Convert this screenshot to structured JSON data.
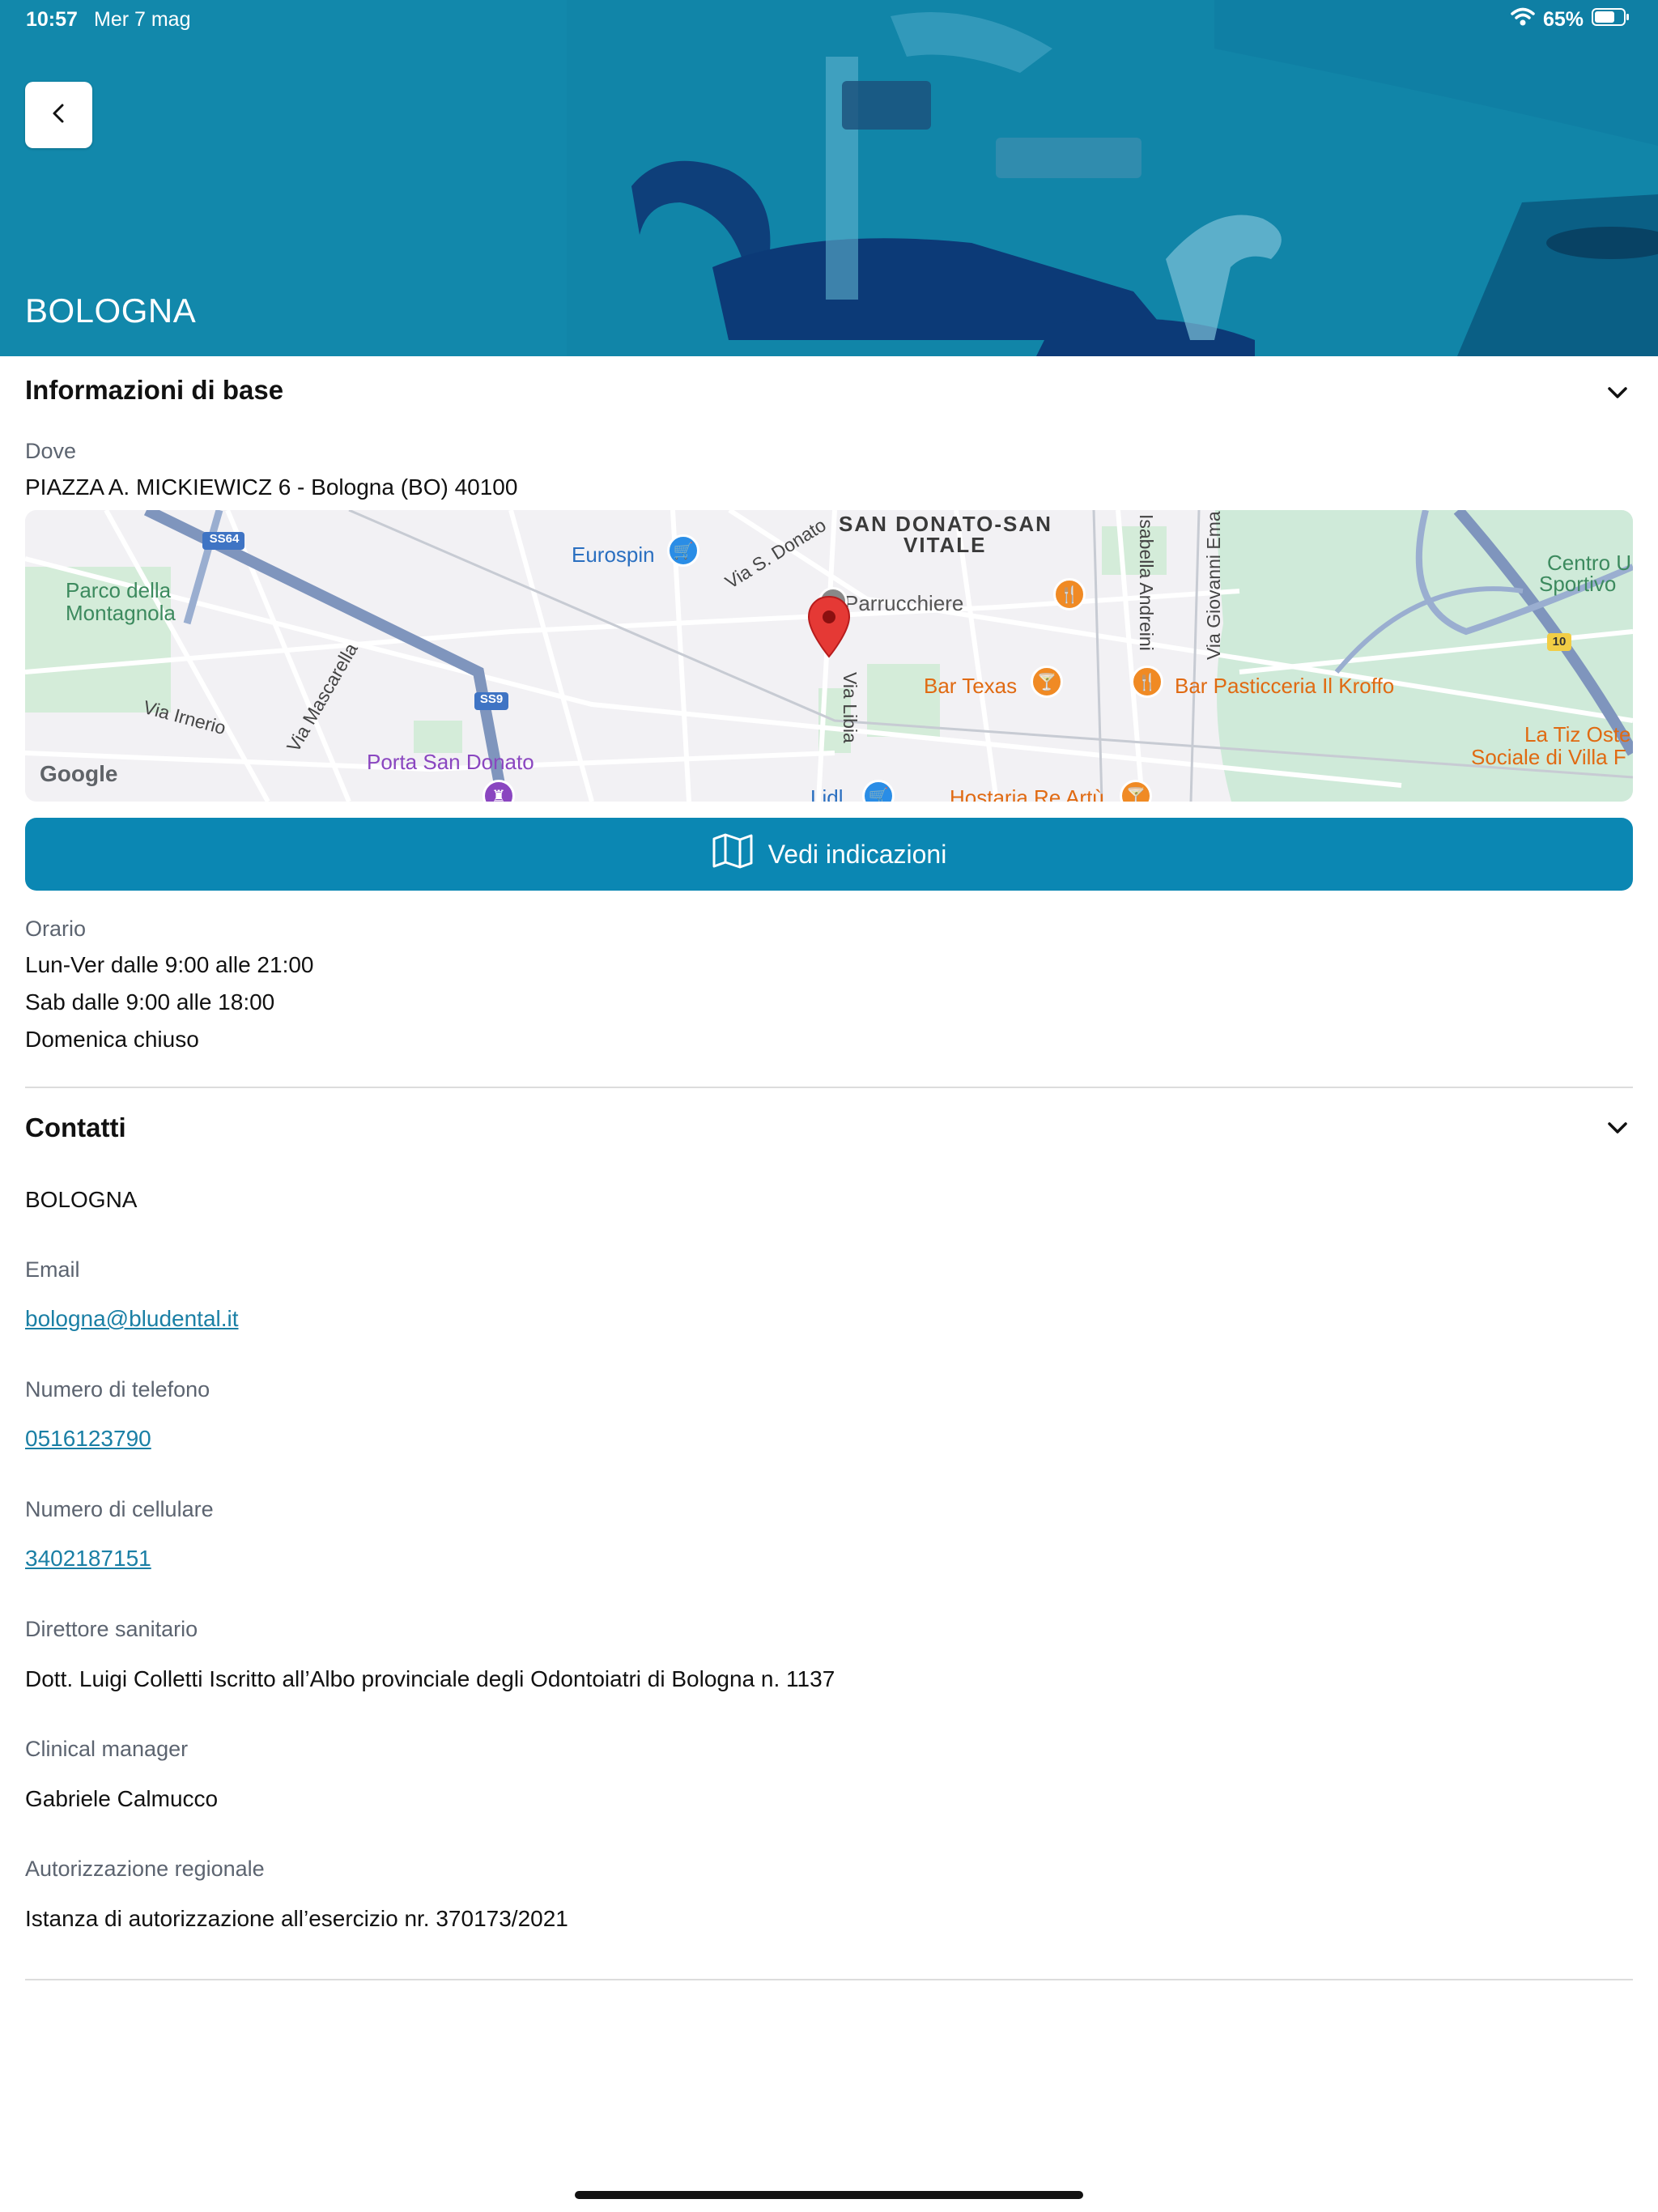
{
  "status_bar": {
    "time": "10:57",
    "date": "Mer 7 mag",
    "battery": "65%"
  },
  "header": {
    "title": "BOLOGNA",
    "back_icon": "chevron-left-icon"
  },
  "info_section": {
    "title": "Informazioni di base",
    "where_label": "Dove",
    "address": "PIAZZA A. MICKIEWICZ 6 - Bologna (BO) 40100",
    "map": {
      "labels": {
        "parco": "Parco della",
        "parco2": "Montagnola",
        "eurospin": "Eurospin",
        "san_donato": "SAN DONATO-SAN",
        "vitale": "VITALE",
        "parrucchiere": "Parrucchiere",
        "via_s_donato": "Via S. Donato",
        "bar_texas": "Bar Texas",
        "bar_pasticceria": "Bar Pasticceria Il Kroffo",
        "centro": "Centro U",
        "sportivo": "Sportivo",
        "via_irnerio": "Via Irnerio",
        "via_mascarella": "Via Mascarella",
        "via_libia": "Via Libia",
        "porta_san_donato": "Porta San Donato",
        "la_tiz": "La Tiz Oste",
        "sociale": "Sociale di Villa F",
        "hostaria": "Hostaria Re Artù",
        "lidl": "Lidl",
        "via_isabella": "Isabella Andreini",
        "via_giovanni": "Via Giovanni Eman",
        "ss64": "SS64",
        "ss9": "SS9",
        "r10": "10",
        "google": "Google"
      }
    },
    "directions_button": "Vedi indicazioni",
    "hours_label": "Orario",
    "hours": [
      "Lun-Ver dalle 9:00 alle 21:00",
      "Sab dalle 9:00 alle 18:00",
      "Domenica chiuso"
    ]
  },
  "contacts_section": {
    "title": "Contatti",
    "name": "BOLOGNA",
    "email_label": "Email",
    "email": "bologna@bludental.it",
    "phone_label": "Numero di telefono",
    "phone": "0516123790",
    "mobile_label": "Numero di cellulare",
    "mobile": "3402187151",
    "director_label": "Direttore sanitario",
    "director": "Dott. Luigi Colletti Iscritto all’Albo provinciale degli Odontoiatri di Bologna n. 1137",
    "clinical_label": "Clinical manager",
    "clinical": "Gabriele Calmucco",
    "authorization_label": "Autorizzazione regionale",
    "authorization": "Istanza di autorizzazione all’esercizio nr. 370173/2021"
  },
  "colors": {
    "brand": "#0b87b3",
    "link": "#1a7fa5",
    "pin": "#e53935"
  }
}
